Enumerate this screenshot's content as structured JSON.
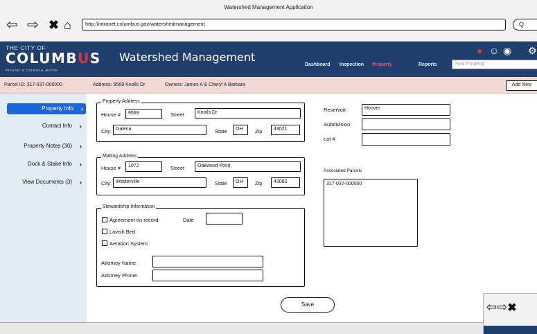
{
  "window": {
    "title": "Watershed Management Application"
  },
  "browser": {
    "back_icon": "back-arrow-icon",
    "forward_icon": "forward-arrow-icon",
    "stop_icon": "close-icon",
    "home_icon": "home-icon",
    "url": "http://intranet.columbus.gov/watershedmanagement",
    "search_value": "Q"
  },
  "header": {
    "logo_small": "THE CITY OF",
    "logo_big_before": "COLUMB",
    "logo_big_accent": "U",
    "logo_big_after": "S",
    "logo_tagline": "MICHAEL B. COLEMAN, MAYOR",
    "app_title": "Watershed Management",
    "nav": [
      {
        "label": "Dashboard",
        "active": false
      },
      {
        "label": "Inspection",
        "active": false
      },
      {
        "label": "Property",
        "active": true
      },
      {
        "label": "Reports",
        "active": false
      }
    ],
    "find_placeholder": "Find Property",
    "icons": [
      "alert-icon",
      "user-icon",
      "globe-icon",
      "gear-icon"
    ],
    "colors": {
      "header_bg": "#1f3f6d",
      "active_nav": "#e45a73",
      "alert": "#e2303b"
    }
  },
  "parcel_bar": {
    "parcel": "Parcel ID: 317-037-000000",
    "address": "Address: 9569 Knolls Dr",
    "owners": "Owners: James A & Cheryl A Barbara",
    "add_new": "Add New"
  },
  "sidebar": {
    "items": [
      {
        "label": "Property Info",
        "active": true
      },
      {
        "label": "Contact Info",
        "active": false
      },
      {
        "label": "Property Notes (30)",
        "active": false
      },
      {
        "label": "Dock & Stake Info",
        "active": false
      },
      {
        "label": "View Documents (3)",
        "active": false
      }
    ],
    "active_color": "#1c66d8"
  },
  "property_address": {
    "legend": "Property Address",
    "house_label": "House #",
    "house_value": "9569",
    "street_label": "Street",
    "street_value": "Knolls Dr",
    "city_label": "City:",
    "city_value": "Galena",
    "state_label": "State",
    "state_value": "OH",
    "zip_label": "Zip",
    "zip_value": "43021"
  },
  "mailing_address": {
    "legend": "Mailing Address",
    "house_label": "House #",
    "house_value": "1072",
    "street_label": "Street",
    "street_value": "Oakwood Point",
    "city_label": "City:",
    "city_value": "Westerville",
    "state_label": "State",
    "state_value": "OH",
    "zip_label": "Zip",
    "zip_value": "43082"
  },
  "stewardship": {
    "legend": "Stewardship Information",
    "agreement_label": "Agreement on record",
    "date_label": "Date",
    "date_value": "",
    "checks": [
      "Lavish Bed",
      "Aeration System"
    ],
    "attorney_name_label": "Attorney Name",
    "attorney_name_value": "",
    "attorney_phone_label": "Attorney Phone",
    "attorney_phone_value": ""
  },
  "reservoir": {
    "reservoir_label": "Reservoir:",
    "reservoir_value": "Hoover",
    "subdivision_label": "Subdivision",
    "subdivision_value": "",
    "lot_label": "Lot #",
    "lot_value": ""
  },
  "associated": {
    "label": "Associated Parcels",
    "items": [
      "317-037-000000"
    ]
  },
  "actions": {
    "save": "Save"
  }
}
